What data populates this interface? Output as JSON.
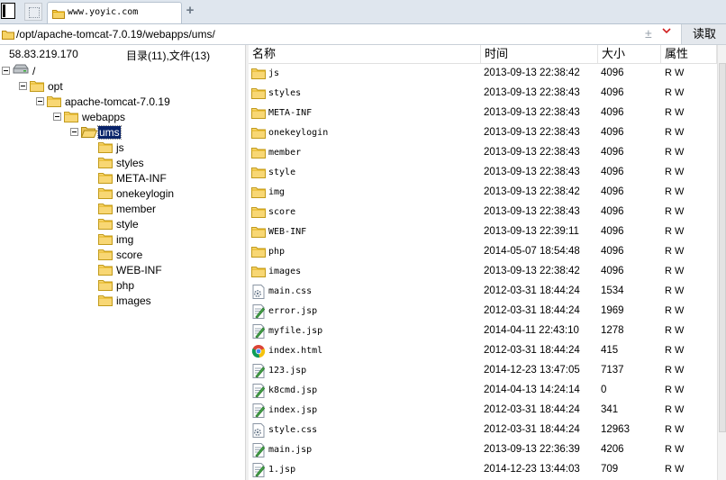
{
  "tab": {
    "title": "www.yoyic.com",
    "close_icon": "close-icon",
    "new_icon": "plus-icon"
  },
  "address": {
    "path": "/opt/apache-tomcat-7.0.19/webapps/ums/",
    "read_label": "读取"
  },
  "left": {
    "ip": "58.83.219.170",
    "summary": "目录(11),文件(13)"
  },
  "tree": [
    {
      "label": "/",
      "icon": "drive-icon",
      "level": 0,
      "expand": true
    },
    {
      "label": "opt",
      "icon": "folder-icon",
      "level": 1,
      "expand": true
    },
    {
      "label": "apache-tomcat-7.0.19",
      "icon": "folder-icon",
      "level": 2,
      "expand": true
    },
    {
      "label": "webapps",
      "icon": "folder-icon",
      "level": 3,
      "expand": true
    },
    {
      "label": "ums",
      "icon": "folder-open-icon",
      "level": 4,
      "expand": true,
      "selected": true
    },
    {
      "label": "js",
      "icon": "folder-icon",
      "level": 5
    },
    {
      "label": "styles",
      "icon": "folder-icon",
      "level": 5
    },
    {
      "label": "META-INF",
      "icon": "folder-icon",
      "level": 5
    },
    {
      "label": "onekeylogin",
      "icon": "folder-icon",
      "level": 5
    },
    {
      "label": "member",
      "icon": "folder-icon",
      "level": 5
    },
    {
      "label": "style",
      "icon": "folder-icon",
      "level": 5
    },
    {
      "label": "img",
      "icon": "folder-icon",
      "level": 5
    },
    {
      "label": "score",
      "icon": "folder-icon",
      "level": 5
    },
    {
      "label": "WEB-INF",
      "icon": "folder-icon",
      "level": 5
    },
    {
      "label": "php",
      "icon": "folder-icon",
      "level": 5
    },
    {
      "label": "images",
      "icon": "folder-icon",
      "level": 5
    }
  ],
  "columns": {
    "name": "名称",
    "time": "时间",
    "size": "大小",
    "perm": "属性"
  },
  "files": [
    {
      "name": "js",
      "time": "2013-09-13 22:38:42",
      "size": "4096",
      "perm": "R W",
      "icon": "folder"
    },
    {
      "name": "styles",
      "time": "2013-09-13 22:38:43",
      "size": "4096",
      "perm": "R W",
      "icon": "folder"
    },
    {
      "name": "META-INF",
      "time": "2013-09-13 22:38:43",
      "size": "4096",
      "perm": "R W",
      "icon": "folder"
    },
    {
      "name": "onekeylogin",
      "time": "2013-09-13 22:38:43",
      "size": "4096",
      "perm": "R W",
      "icon": "folder"
    },
    {
      "name": "member",
      "time": "2013-09-13 22:38:43",
      "size": "4096",
      "perm": "R W",
      "icon": "folder"
    },
    {
      "name": "style",
      "time": "2013-09-13 22:38:43",
      "size": "4096",
      "perm": "R W",
      "icon": "folder"
    },
    {
      "name": "img",
      "time": "2013-09-13 22:38:42",
      "size": "4096",
      "perm": "R W",
      "icon": "folder"
    },
    {
      "name": "score",
      "time": "2013-09-13 22:38:43",
      "size": "4096",
      "perm": "R W",
      "icon": "folder"
    },
    {
      "name": "WEB-INF",
      "time": "2013-09-13 22:39:11",
      "size": "4096",
      "perm": "R W",
      "icon": "folder"
    },
    {
      "name": "php",
      "time": "2014-05-07 18:54:48",
      "size": "4096",
      "perm": "R W",
      "icon": "folder"
    },
    {
      "name": "images",
      "time": "2013-09-13 22:38:42",
      "size": "4096",
      "perm": "R W",
      "icon": "folder"
    },
    {
      "name": "main.css",
      "time": "2012-03-31 18:44:24",
      "size": "1534",
      "perm": "R W",
      "icon": "css"
    },
    {
      "name": "error.jsp",
      "time": "2012-03-31 18:44:24",
      "size": "1969",
      "perm": "R W",
      "icon": "jsp"
    },
    {
      "name": "myfile.jsp",
      "time": "2014-04-11 22:43:10",
      "size": "1278",
      "perm": "R W",
      "icon": "jsp"
    },
    {
      "name": "index.html",
      "time": "2012-03-31 18:44:24",
      "size": "415",
      "perm": "R W",
      "icon": "html"
    },
    {
      "name": "123.jsp",
      "time": "2014-12-23 13:47:05",
      "size": "7137",
      "perm": "R W",
      "icon": "jsp"
    },
    {
      "name": "k8cmd.jsp",
      "time": "2014-04-13 14:24:14",
      "size": "0",
      "perm": "R W",
      "icon": "jsp"
    },
    {
      "name": "index.jsp",
      "time": "2012-03-31 18:44:24",
      "size": "341",
      "perm": "R W",
      "icon": "jsp"
    },
    {
      "name": "style.css",
      "time": "2012-03-31 18:44:24",
      "size": "12963",
      "perm": "R W",
      "icon": "css"
    },
    {
      "name": "main.jsp",
      "time": "2013-09-13 22:36:39",
      "size": "4206",
      "perm": "R W",
      "icon": "jsp"
    },
    {
      "name": "1.jsp",
      "time": "2014-12-23 13:44:03",
      "size": "709",
      "perm": "R W",
      "icon": "jsp"
    }
  ]
}
